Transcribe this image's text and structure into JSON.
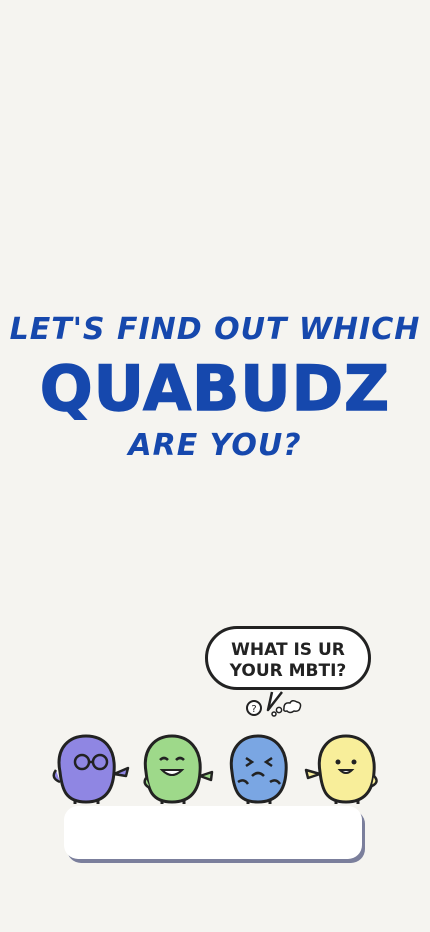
{
  "headline": {
    "line1": "LET'S FIND OUT WHICH",
    "brand": "QUABUDZ",
    "line3": "ARE YOU?"
  },
  "speech_bubble": {
    "line1": "WHAT IS    UR",
    "line2": "YOUR MBTI?"
  },
  "colors": {
    "brand_blue": "#1648ad",
    "background": "#f5f4f0",
    "purple": "#8f86e3",
    "green": "#9ed98a",
    "blue": "#7aa6e3",
    "yellow": "#f8ee9a"
  }
}
